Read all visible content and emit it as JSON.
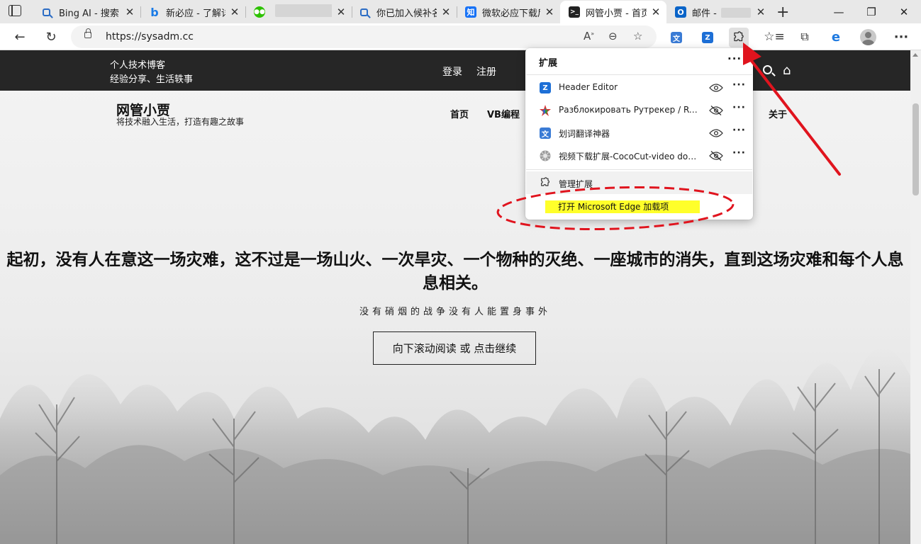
{
  "tabs": [
    {
      "title": "Bing AI - 搜索",
      "icon": "search-icon",
      "active": false
    },
    {
      "title": "新必应 - 了解详",
      "icon": "bing-icon",
      "active": false
    },
    {
      "title": "",
      "icon": "wechat-icon",
      "active": false
    },
    {
      "title": "你已加入候补名",
      "icon": "search-icon",
      "active": false
    },
    {
      "title": "微软必应下载后",
      "icon": "zhihu-icon",
      "icon_text": "知",
      "active": false
    },
    {
      "title": "网管小贾 - 首页",
      "icon": "terminal-icon",
      "icon_text": ">_",
      "active": true
    },
    {
      "title": "邮件 -",
      "icon": "outlook-icon",
      "icon_text": "O",
      "active": false
    }
  ],
  "toolbar": {
    "url": "https://sysadm.cc"
  },
  "site": {
    "tagline1": "个人技术博客",
    "tagline2": "经验分享、生活轶事",
    "login": "登录",
    "register": "注册",
    "title": "网管小贾",
    "description": "将技术融入生活，打造有趣之故事",
    "nav": [
      "首页",
      "VB编程",
      "关于"
    ],
    "headline": "起初，没有人在意这一场灾难，这不过是一场山火、一次旱灾、一个物种的灭绝、一座城市的消失，直到这场灾难和每个人息息相关。",
    "subline": "没有硝烟的战争没有人能置身事外",
    "cta": "向下滚动阅读 或 点击继续"
  },
  "extensions_popup": {
    "title": "扩展",
    "more": "···",
    "items": [
      {
        "name": "Header Editor",
        "icon": "header-editor-icon",
        "visibility": "shown"
      },
      {
        "name": "Разблокировать Рутрекер / Rutra...",
        "icon": "rutracker-icon",
        "visibility": "hidden"
      },
      {
        "name": "划词翻译神器",
        "icon": "translate-icon",
        "visibility": "shown"
      },
      {
        "name": "视频下载扩展-CocoCut-video dow...",
        "icon": "cococut-icon",
        "visibility": "hidden"
      }
    ],
    "manage": "管理扩展",
    "open_addons": "打开 Microsoft Edge 加载项"
  },
  "colors": {
    "highlight": "#ffff2a",
    "annotation_red": "#e0141e",
    "dark_bar": "#262626"
  }
}
